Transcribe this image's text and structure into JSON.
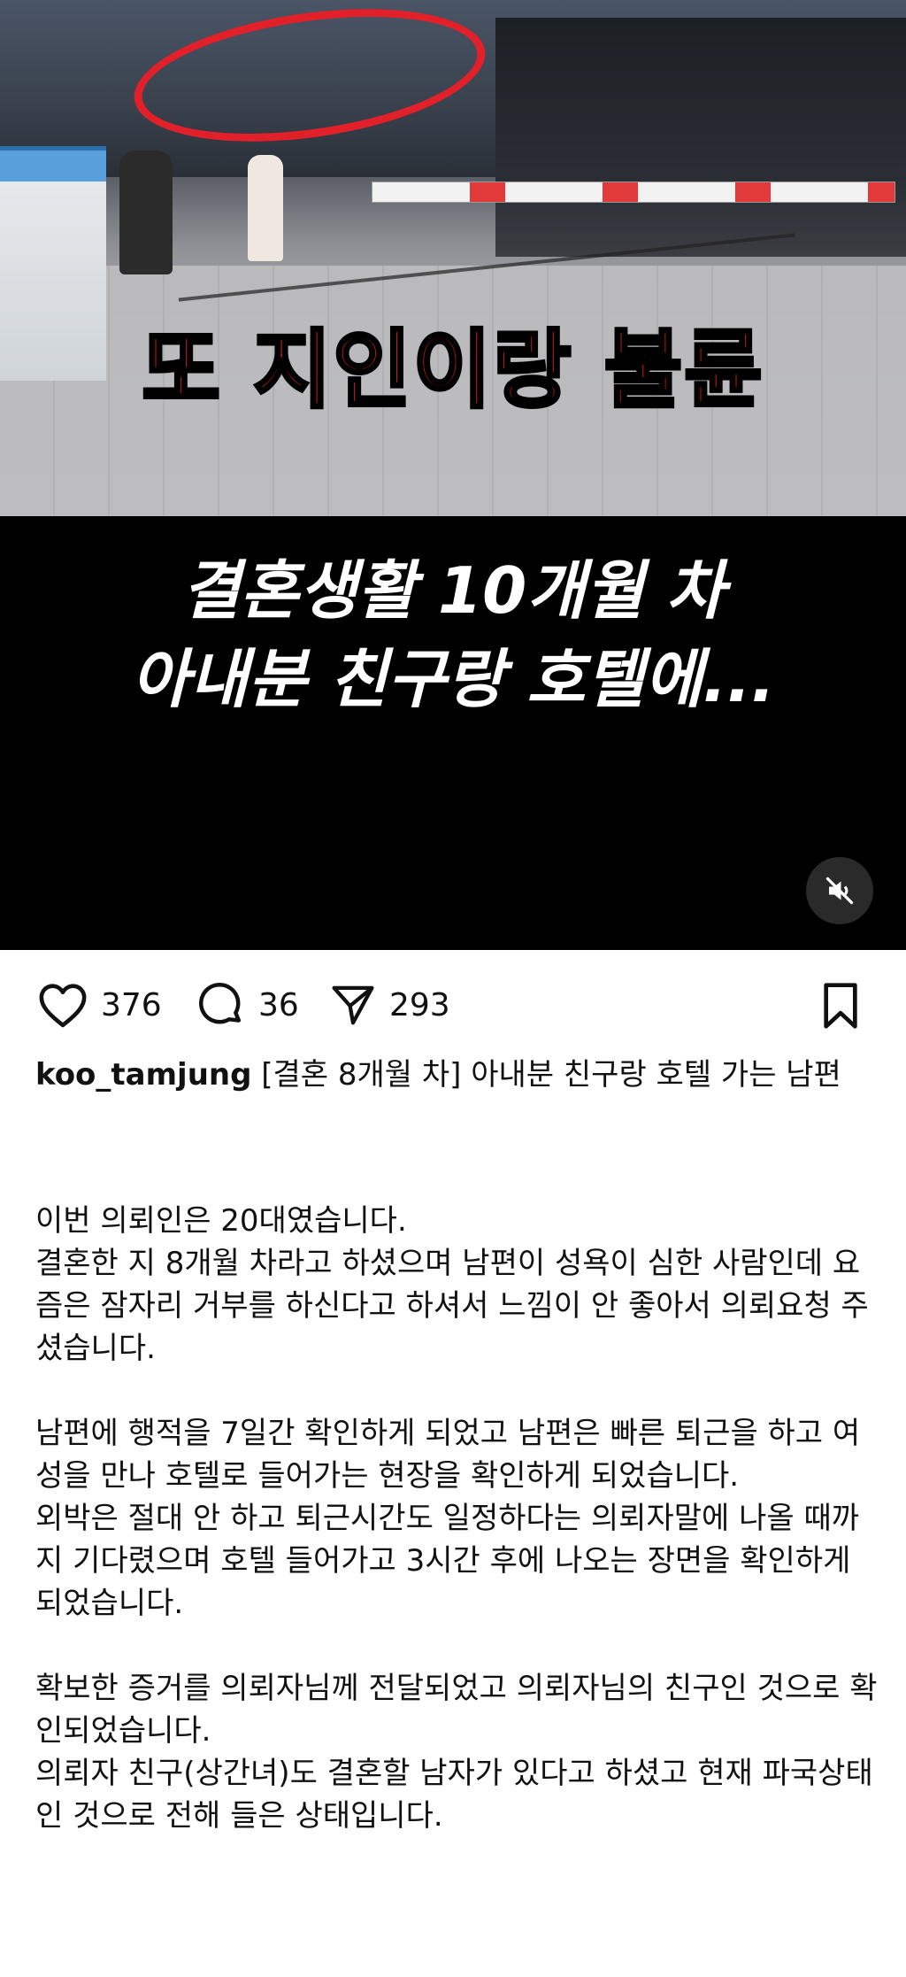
{
  "media": {
    "overlay_red_text": "또 지인이랑 불륜",
    "overlay_white_line1": "결혼생활 10개월 차",
    "overlay_white_line2": "아내분 친구랑 호텔에...",
    "mute_icon": "speaker-muted-icon"
  },
  "actions": {
    "likes": "376",
    "comments": "36",
    "shares": "293",
    "like_icon": "heart-icon",
    "comment_icon": "comment-bubble-icon",
    "share_icon": "send-icon",
    "bookmark_icon": "bookmark-icon"
  },
  "post": {
    "username": "koo_tamjung",
    "title": "[결혼 8개월 차] 아내분 친구랑 호텔 가는 남편",
    "paragraphs": [
      "이번 의뢰인은 20대였습니다.",
      "결혼한 지 8개월 차라고 하셨으며 남편이 성욕이 심한 사람인데 요즘은 잠자리 거부를 하신다고 하셔서 느낌이 안 좋아서 의뢰요청 주셨습니다.",
      "",
      "남편에 행적을 7일간 확인하게 되었고 남편은 빠른 퇴근을 하고 여성을 만나 호텔로 들어가는 현장을 확인하게 되었습니다.",
      "외박은 절대 안 하고 퇴근시간도 일정하다는 의뢰자말에 나올 때까지 기다렸으며 호텔 들어가고 3시간 후에 나오는 장면을 확인하게 되었습니다.",
      "",
      "확보한 증거를 의뢰자님께 전달되었고 의뢰자님의 친구인 것으로 확인되었습니다.",
      "의뢰자 친구(상간녀)도 결혼할 남자가 있다고 하셨고 현재 파국상태인 것으로 전해 들은 상태입니다."
    ]
  },
  "colors": {
    "accent_red": "#d91a1a",
    "circle_red": "#e1202a",
    "text": "#111111",
    "background": "#ffffff"
  }
}
